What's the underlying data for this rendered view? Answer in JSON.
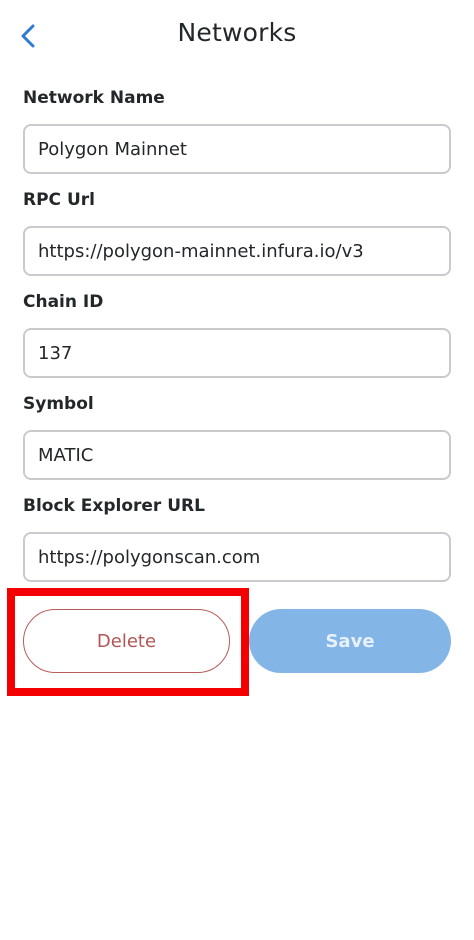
{
  "header": {
    "title": "Networks",
    "back_icon": "chevron-left-icon",
    "accent_color": "#2f7bd4"
  },
  "form": {
    "network_name": {
      "label": "Network Name",
      "value": "Polygon Mainnet"
    },
    "rpc_url": {
      "label": "RPC Url",
      "value": "https://polygon-mainnet.infura.io/v3"
    },
    "chain_id": {
      "label": "Chain ID",
      "value": "137"
    },
    "symbol": {
      "label": "Symbol",
      "value": "MATIC"
    },
    "block_explorer_url": {
      "label": "Block Explorer URL",
      "value": "https://polygonscan.com"
    }
  },
  "actions": {
    "delete_label": "Delete",
    "save_label": "Save",
    "delete_color": "#b45454",
    "save_color": "#83b6e7",
    "highlight_color": "#f40000"
  }
}
